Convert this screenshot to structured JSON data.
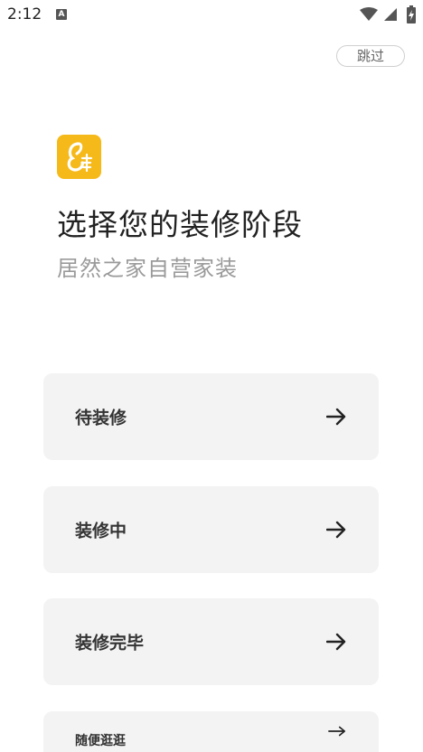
{
  "status_bar": {
    "time": "2:12",
    "notification_icon": "A",
    "icons": [
      "wifi-icon",
      "signal-icon",
      "battery-charging-icon"
    ]
  },
  "skip_label": "跳过",
  "logo": {
    "icon": "app-logo-icon",
    "color": "#f6b91a"
  },
  "title": "选择您的装修阶段",
  "subtitle": "居然之家自营家装",
  "options": [
    {
      "label": "待装修",
      "icon": "arrow-right-icon"
    },
    {
      "label": "装修中",
      "icon": "arrow-right-icon"
    },
    {
      "label": "装修完毕",
      "icon": "arrow-right-icon"
    },
    {
      "label": "随便逛逛",
      "icon": "arrow-right-icon"
    }
  ],
  "colors": {
    "background": "#ffffff",
    "card_background": "#f3f3f3",
    "title_text": "#222222",
    "subtitle_text": "#9a9a9a",
    "accent": "#f6b91a"
  }
}
